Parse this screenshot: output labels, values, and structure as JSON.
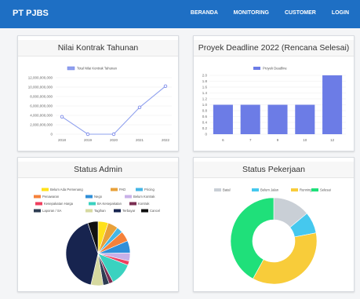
{
  "navbar": {
    "brand": "PT PJBS",
    "links": [
      "BERANDA",
      "MONITORING",
      "CUSTOMER",
      "LOGIN"
    ]
  },
  "colors": {
    "navbar": "#1e6fc4",
    "line": "#7b8ce8",
    "bar": "#6c7ce6"
  },
  "chart_data": [
    {
      "type": "line",
      "title": "Nilai Kontrak Tahunan",
      "legend": [
        "Total Nilai Kontrak Tahunan"
      ],
      "x": [
        "2018",
        "2019",
        "2020",
        "2021",
        "2022"
      ],
      "series": [
        {
          "name": "Total Nilai Kontrak Tahunan",
          "values": [
            3700000000,
            0,
            0,
            5700000000,
            10200000000
          ]
        }
      ],
      "ylim": [
        0,
        12000000000
      ],
      "yticks": [
        "0",
        "2,000,000,000",
        "4,000,000,000",
        "6,000,000,000",
        "8,000,000,000",
        "10,000,000,000",
        "12,000,000,000"
      ]
    },
    {
      "type": "bar",
      "title": "Proyek Deadline 2022 (Rencana Selesai)",
      "legend": [
        "Proyek Deadline"
      ],
      "categories": [
        "6",
        "7",
        "9",
        "10",
        "12"
      ],
      "values": [
        1,
        1,
        1,
        1,
        2
      ],
      "ylim": [
        0,
        2
      ],
      "yticks": [
        "0",
        "0.2",
        "0.4",
        "0.6",
        "0.8",
        "1.0",
        "1.2",
        "1.4",
        "1.6",
        "1.8",
        "2.0"
      ]
    },
    {
      "type": "pie",
      "title": "Status Admin",
      "legend": [
        {
          "label": "Belum Ada Pemenang",
          "color": "#ffe11a"
        },
        {
          "label": "PAD",
          "color": "#e8a13a"
        },
        {
          "label": "Pricing",
          "color": "#45b6e6"
        },
        {
          "label": "Penawaran",
          "color": "#f5813a"
        },
        {
          "label": "Nego",
          "color": "#2f8fd8"
        },
        {
          "label": "Belum Kontrak",
          "color": "#c8b0e8"
        },
        {
          "label": "Kesepakatan Harga",
          "color": "#ef3f5e"
        },
        {
          "label": "BA Kesepakatan",
          "color": "#3ad2c0"
        },
        {
          "label": "Kontrak",
          "color": "#7a2e52"
        },
        {
          "label": "Laporan / SA",
          "color": "#2e3d52"
        },
        {
          "label": "Tagihan",
          "color": "#d6d9a0"
        },
        {
          "label": "Terbayar",
          "color": "#17244f"
        },
        {
          "label": "Cancel",
          "color": "#101010"
        }
      ],
      "values": [
        5,
        5,
        3,
        5,
        6,
        4,
        2,
        11,
        2,
        3,
        6,
        40,
        5
      ]
    },
    {
      "type": "pie",
      "title": "Status Pekerjaan",
      "legend": [
        {
          "label": "Batal",
          "color": "#c9cfd6"
        },
        {
          "label": "Belum Jalan",
          "color": "#45c8ee"
        },
        {
          "label": "Running",
          "color": "#f8cc3a"
        },
        {
          "label": "Selesai",
          "color": "#1fe07a"
        }
      ],
      "values": [
        14,
        8,
        36,
        42
      ]
    }
  ]
}
